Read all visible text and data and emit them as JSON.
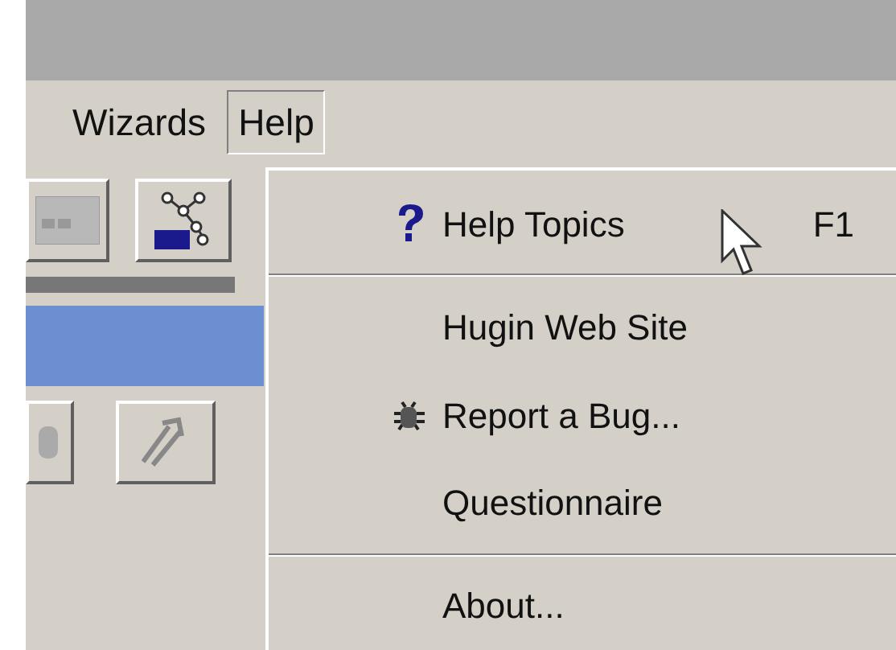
{
  "menubar": [
    {
      "label": "Wizards",
      "selected": false
    },
    {
      "label": "Help",
      "selected": true
    }
  ],
  "help_menu": {
    "items": [
      {
        "kind": "help_item",
        "label": "Help Topics",
        "shortcut": "F1"
      },
      {
        "kind": "separator"
      },
      {
        "kind": "item",
        "label": "Hugin Web Site"
      },
      {
        "kind": "bug_item",
        "label": "Report a Bug..."
      },
      {
        "kind": "item",
        "label": "Questionnaire"
      },
      {
        "kind": "separator"
      },
      {
        "kind": "item",
        "label": "About..."
      }
    ]
  }
}
